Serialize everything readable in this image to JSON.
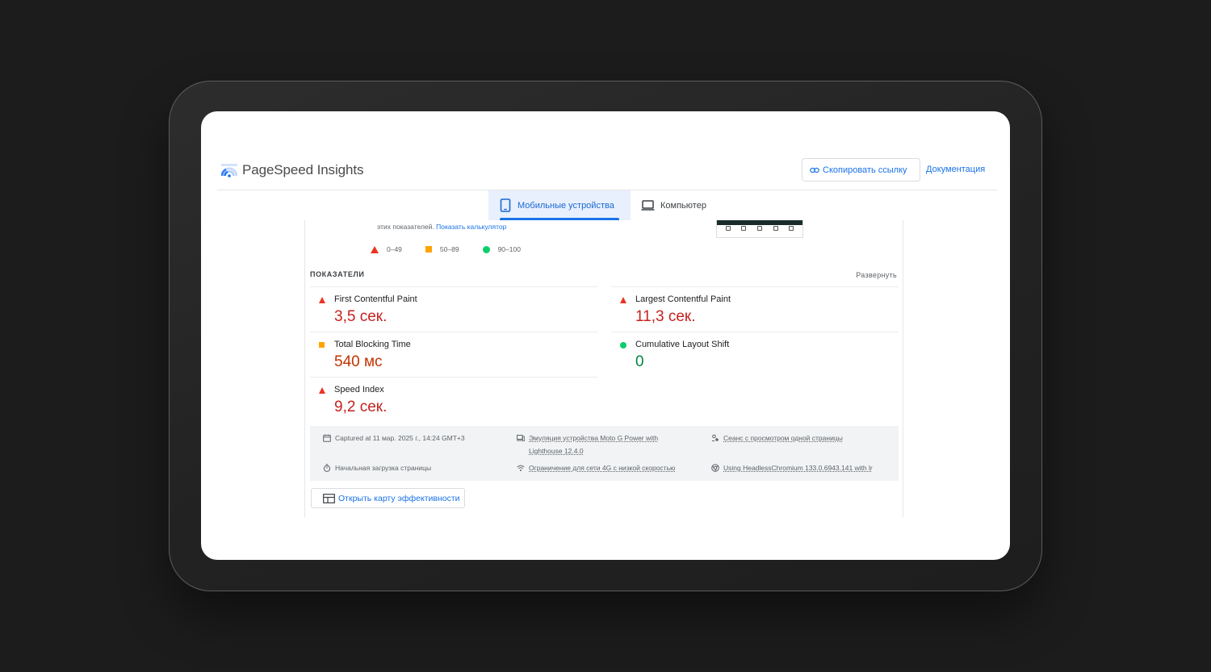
{
  "app": {
    "logo_text": "PageSpeed Insights"
  },
  "header": {
    "copy_link_label": "Скопировать ссылку",
    "docs_label": "Документация"
  },
  "tabs": [
    {
      "label": "Мобильные устройства",
      "active": true
    },
    {
      "label": "Компьютер",
      "active": false
    }
  ],
  "info": {
    "text": "этих показателей.",
    "link": "Показать калькулятор"
  },
  "legend": [
    {
      "range": "0–49",
      "icon": "red-triangle-icon"
    },
    {
      "range": "50–89",
      "icon": "orange-square-icon"
    },
    {
      "range": "90–100",
      "icon": "green-circle-icon"
    }
  ],
  "metrics": {
    "section_label": "ПОКАЗАТЕЛИ",
    "expand_label": "Развернуть",
    "items": [
      {
        "name": "First Contentful Paint",
        "value": "3,5 сек.",
        "status": "fail"
      },
      {
        "name": "Largest Contentful Paint",
        "value": "11,3 сек.",
        "status": "fail"
      },
      {
        "name": "Total Blocking Time",
        "value": "540 мс",
        "status": "average"
      },
      {
        "name": "Cumulative Layout Shift",
        "value": "0",
        "status": "pass"
      },
      {
        "name": "Speed Index",
        "value": "9,2 сек.",
        "status": "fail"
      }
    ]
  },
  "environment": {
    "captured": "Captured at 11 мар. 2025 г., 14:24 GMT+3",
    "emulation_line1": "Эмуляция устройства Moto G Power with",
    "emulation_line2": "Lighthouse 12.4.0",
    "session": "Сеанс с просмотром одной страницы",
    "initial_load": "Начальная загрузка страницы",
    "throttling": "Ограничение для сети 4G с низкой скоростью",
    "browser": "Using HeadlessChromium 133.0.6943.141 with lr"
  },
  "treemap_label": "Открыть карту эффективности",
  "colors": {
    "accent": "#1a73e8",
    "fail": "#eb3323",
    "average": "#ffa400",
    "pass": "#0cce6b"
  }
}
